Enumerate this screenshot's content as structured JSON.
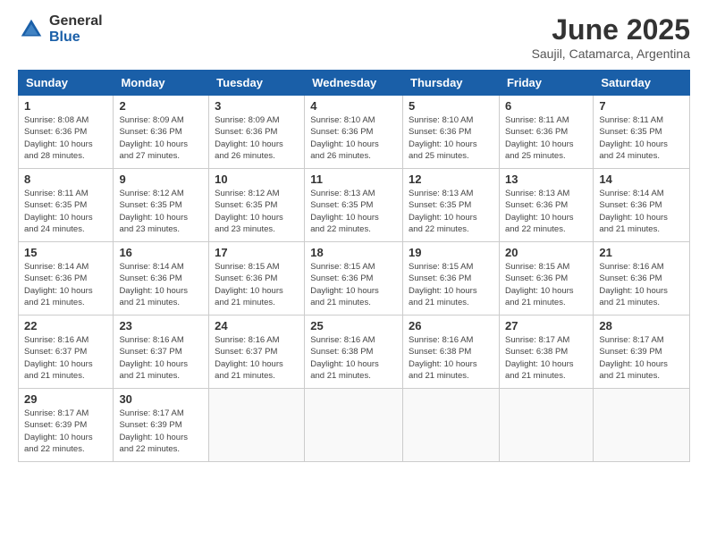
{
  "logo": {
    "general": "General",
    "blue": "Blue"
  },
  "title": {
    "month_year": "June 2025",
    "location": "Saujil, Catamarca, Argentina"
  },
  "weekdays": [
    "Sunday",
    "Monday",
    "Tuesday",
    "Wednesday",
    "Thursday",
    "Friday",
    "Saturday"
  ],
  "weeks": [
    [
      {
        "day": "1",
        "info": "Sunrise: 8:08 AM\nSunset: 6:36 PM\nDaylight: 10 hours\nand 28 minutes."
      },
      {
        "day": "2",
        "info": "Sunrise: 8:09 AM\nSunset: 6:36 PM\nDaylight: 10 hours\nand 27 minutes."
      },
      {
        "day": "3",
        "info": "Sunrise: 8:09 AM\nSunset: 6:36 PM\nDaylight: 10 hours\nand 26 minutes."
      },
      {
        "day": "4",
        "info": "Sunrise: 8:10 AM\nSunset: 6:36 PM\nDaylight: 10 hours\nand 26 minutes."
      },
      {
        "day": "5",
        "info": "Sunrise: 8:10 AM\nSunset: 6:36 PM\nDaylight: 10 hours\nand 25 minutes."
      },
      {
        "day": "6",
        "info": "Sunrise: 8:11 AM\nSunset: 6:36 PM\nDaylight: 10 hours\nand 25 minutes."
      },
      {
        "day": "7",
        "info": "Sunrise: 8:11 AM\nSunset: 6:35 PM\nDaylight: 10 hours\nand 24 minutes."
      }
    ],
    [
      {
        "day": "8",
        "info": "Sunrise: 8:11 AM\nSunset: 6:35 PM\nDaylight: 10 hours\nand 24 minutes."
      },
      {
        "day": "9",
        "info": "Sunrise: 8:12 AM\nSunset: 6:35 PM\nDaylight: 10 hours\nand 23 minutes."
      },
      {
        "day": "10",
        "info": "Sunrise: 8:12 AM\nSunset: 6:35 PM\nDaylight: 10 hours\nand 23 minutes."
      },
      {
        "day": "11",
        "info": "Sunrise: 8:13 AM\nSunset: 6:35 PM\nDaylight: 10 hours\nand 22 minutes."
      },
      {
        "day": "12",
        "info": "Sunrise: 8:13 AM\nSunset: 6:35 PM\nDaylight: 10 hours\nand 22 minutes."
      },
      {
        "day": "13",
        "info": "Sunrise: 8:13 AM\nSunset: 6:36 PM\nDaylight: 10 hours\nand 22 minutes."
      },
      {
        "day": "14",
        "info": "Sunrise: 8:14 AM\nSunset: 6:36 PM\nDaylight: 10 hours\nand 21 minutes."
      }
    ],
    [
      {
        "day": "15",
        "info": "Sunrise: 8:14 AM\nSunset: 6:36 PM\nDaylight: 10 hours\nand 21 minutes."
      },
      {
        "day": "16",
        "info": "Sunrise: 8:14 AM\nSunset: 6:36 PM\nDaylight: 10 hours\nand 21 minutes."
      },
      {
        "day": "17",
        "info": "Sunrise: 8:15 AM\nSunset: 6:36 PM\nDaylight: 10 hours\nand 21 minutes."
      },
      {
        "day": "18",
        "info": "Sunrise: 8:15 AM\nSunset: 6:36 PM\nDaylight: 10 hours\nand 21 minutes."
      },
      {
        "day": "19",
        "info": "Sunrise: 8:15 AM\nSunset: 6:36 PM\nDaylight: 10 hours\nand 21 minutes."
      },
      {
        "day": "20",
        "info": "Sunrise: 8:15 AM\nSunset: 6:36 PM\nDaylight: 10 hours\nand 21 minutes."
      },
      {
        "day": "21",
        "info": "Sunrise: 8:16 AM\nSunset: 6:36 PM\nDaylight: 10 hours\nand 21 minutes."
      }
    ],
    [
      {
        "day": "22",
        "info": "Sunrise: 8:16 AM\nSunset: 6:37 PM\nDaylight: 10 hours\nand 21 minutes."
      },
      {
        "day": "23",
        "info": "Sunrise: 8:16 AM\nSunset: 6:37 PM\nDaylight: 10 hours\nand 21 minutes."
      },
      {
        "day": "24",
        "info": "Sunrise: 8:16 AM\nSunset: 6:37 PM\nDaylight: 10 hours\nand 21 minutes."
      },
      {
        "day": "25",
        "info": "Sunrise: 8:16 AM\nSunset: 6:38 PM\nDaylight: 10 hours\nand 21 minutes."
      },
      {
        "day": "26",
        "info": "Sunrise: 8:16 AM\nSunset: 6:38 PM\nDaylight: 10 hours\nand 21 minutes."
      },
      {
        "day": "27",
        "info": "Sunrise: 8:17 AM\nSunset: 6:38 PM\nDaylight: 10 hours\nand 21 minutes."
      },
      {
        "day": "28",
        "info": "Sunrise: 8:17 AM\nSunset: 6:39 PM\nDaylight: 10 hours\nand 21 minutes."
      }
    ],
    [
      {
        "day": "29",
        "info": "Sunrise: 8:17 AM\nSunset: 6:39 PM\nDaylight: 10 hours\nand 22 minutes."
      },
      {
        "day": "30",
        "info": "Sunrise: 8:17 AM\nSunset: 6:39 PM\nDaylight: 10 hours\nand 22 minutes."
      },
      {
        "day": "",
        "info": ""
      },
      {
        "day": "",
        "info": ""
      },
      {
        "day": "",
        "info": ""
      },
      {
        "day": "",
        "info": ""
      },
      {
        "day": "",
        "info": ""
      }
    ]
  ]
}
